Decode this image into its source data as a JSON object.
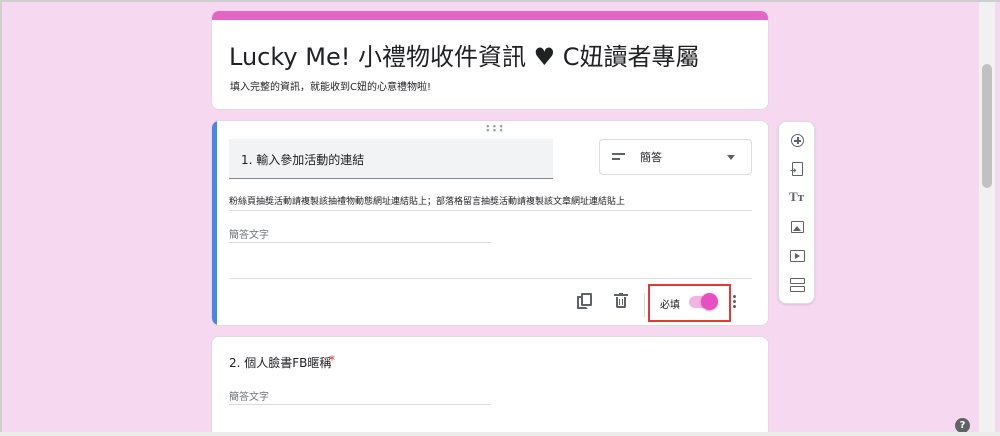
{
  "form": {
    "title": "Lucky Me!  小禮物收件資訊 ♥ C妞讀者專屬",
    "description": "填入完整的資訊，就能收到C妞的心意禮物啦!"
  },
  "question1": {
    "title": "1. 輸入參加活動的連結",
    "type_label": "簡答",
    "description": "粉絲頁抽獎活動請複製該抽禮物動態網址連結貼上；部落格留言抽獎活動請複製該文章網址連結貼上",
    "answer_placeholder": "簡答文字",
    "required_label": "必填",
    "required_on": true
  },
  "question2": {
    "title": "2. 個人臉書FB暱稱",
    "required_mark": "*",
    "answer_placeholder": "簡答文字"
  },
  "colors": {
    "background": "#f6d9f0",
    "accent": "#e366c6",
    "active_bar": "#4a86e8",
    "toggle_thumb": "#e84fc3",
    "highlight_box": "#e53935"
  },
  "icons": {
    "drag": "drag-handle-icon",
    "type": "short-answer-icon",
    "copy": "copy-icon",
    "delete": "trash-icon",
    "more": "more-vert-icon",
    "toolbar": [
      "add-question-icon",
      "import-questions-icon",
      "title-text-icon",
      "image-icon",
      "video-icon",
      "section-icon"
    ],
    "help": "help-icon"
  },
  "help": {
    "glyph": "?"
  }
}
